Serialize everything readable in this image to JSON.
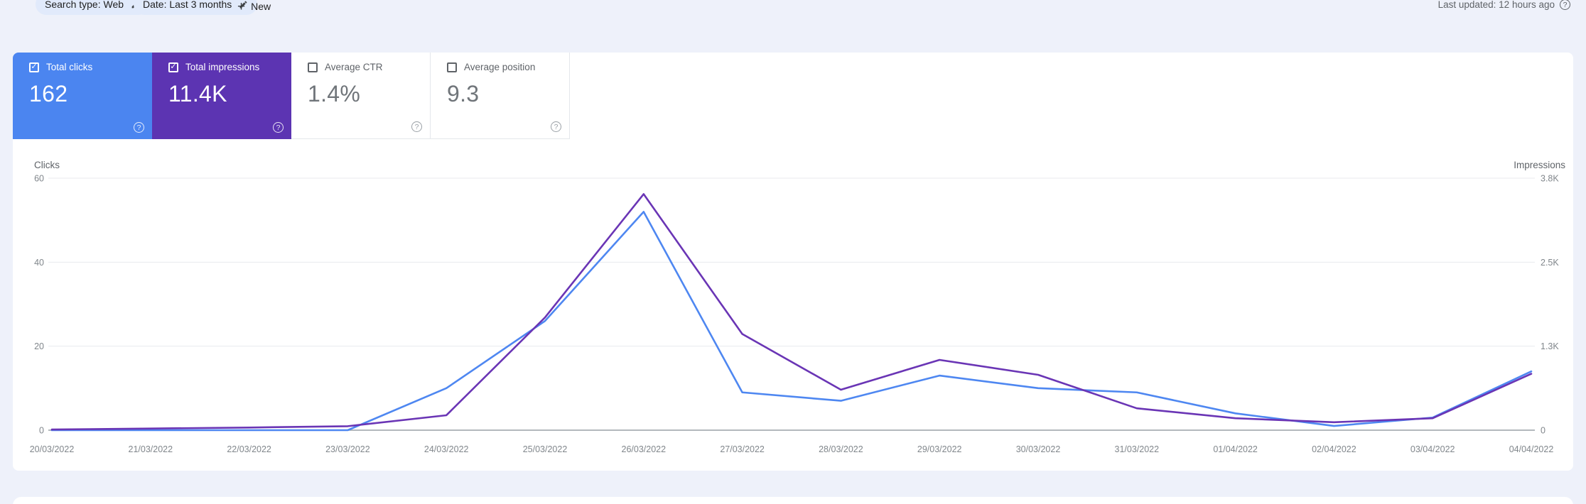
{
  "toolbar": {
    "chips": [
      {
        "label": "Search type: Web"
      },
      {
        "label": "Date: Last 3 months"
      }
    ],
    "new_button_label": "New",
    "last_updated": "Last updated: 12 hours ago"
  },
  "cards": [
    {
      "label": "Total clicks",
      "value": "162",
      "checked": true,
      "color": "#4b85f0"
    },
    {
      "label": "Total impressions",
      "value": "11.4K",
      "checked": true,
      "color": "#5c34b2"
    },
    {
      "label": "Average CTR",
      "value": "1.4%",
      "checked": false,
      "color": "#ffffff"
    },
    {
      "label": "Average position",
      "value": "9.3",
      "checked": false,
      "color": "#ffffff"
    }
  ],
  "chart_data": {
    "type": "line",
    "x": [
      "20/03/2022",
      "21/03/2022",
      "22/03/2022",
      "23/03/2022",
      "24/03/2022",
      "25/03/2022",
      "26/03/2022",
      "27/03/2022",
      "28/03/2022",
      "29/03/2022",
      "30/03/2022",
      "31/03/2022",
      "01/04/2022",
      "02/04/2022",
      "03/04/2022",
      "04/04/2022"
    ],
    "series": [
      {
        "name": "Clicks",
        "axis": "left",
        "color": "#4e87f1",
        "values": [
          0,
          0,
          0,
          0,
          10,
          26,
          52,
          9,
          7,
          13,
          10,
          9,
          4,
          1,
          3,
          14
        ]
      },
      {
        "name": "Impressions",
        "axis": "right",
        "color": "#6a35b5",
        "values": [
          10,
          25,
          40,
          60,
          225,
          1700,
          3560,
          1450,
          610,
          1060,
          835,
          330,
          180,
          120,
          180,
          850
        ]
      }
    ],
    "left_axis": {
      "title": "Clicks",
      "tick_labels": [
        "0",
        "20",
        "40",
        "60"
      ],
      "tick_values": [
        0,
        20,
        40,
        60
      ],
      "max": 60
    },
    "right_axis": {
      "title": "Impressions",
      "tick_labels": [
        "0",
        "1.3K",
        "2.5K",
        "3.8K"
      ],
      "tick_values": [
        0,
        1267,
        2533,
        3800
      ],
      "max": 3800
    },
    "grid": "horizontal",
    "legend": "none",
    "colors": {
      "grid": "#e8eaed",
      "axis": "#9aa0a6",
      "tick_text": "#80868b",
      "axis_title": "#5f6368"
    }
  }
}
